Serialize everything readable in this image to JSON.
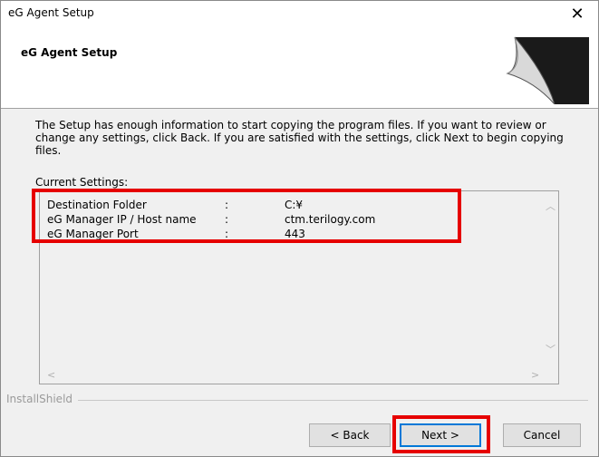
{
  "window": {
    "title": "eG Agent Setup",
    "close_glyph": "✕"
  },
  "header": {
    "title": "eG Agent Setup"
  },
  "intro_text": "The Setup has enough information to start copying the program files. If you want to review or change any settings, click Back. If you are satisfied with the settings, click Next to begin copying files.",
  "current_settings": {
    "label": "Current Settings:",
    "rows": [
      {
        "key": "Destination Folder",
        "sep": ":",
        "value": "C:¥"
      },
      {
        "key": "eG Manager IP / Host name",
        "sep": ":",
        "value": "ctm.terilogy.com"
      },
      {
        "key": "eG Manager Port",
        "sep": ":",
        "value": "443"
      }
    ]
  },
  "footer": {
    "brand": "InstallShield"
  },
  "buttons": {
    "back": "< Back",
    "next": "Next >",
    "cancel": "Cancel"
  },
  "highlight_color": "#e60000"
}
